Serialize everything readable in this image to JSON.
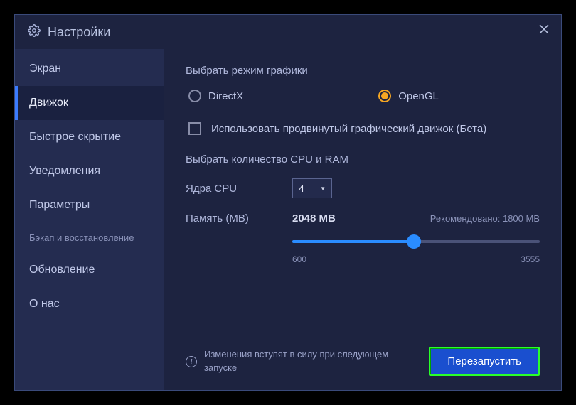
{
  "window": {
    "title": "Настройки"
  },
  "sidebar": {
    "items": [
      {
        "label": "Экран",
        "active": false,
        "small": false
      },
      {
        "label": "Движок",
        "active": true,
        "small": false
      },
      {
        "label": "Быстрое скрытие",
        "active": false,
        "small": false
      },
      {
        "label": "Уведомления",
        "active": false,
        "small": false
      },
      {
        "label": "Параметры",
        "active": false,
        "small": false
      },
      {
        "label": "Бэкап и восстановление",
        "active": false,
        "small": true
      },
      {
        "label": "Обновление",
        "active": false,
        "small": false
      },
      {
        "label": "О нас",
        "active": false,
        "small": false
      }
    ]
  },
  "content": {
    "graphics_mode_title": "Выбрать режим графики",
    "radio_directx": "DirectX",
    "radio_opengl": "OpenGL",
    "selected_graphics": "OpenGL",
    "advanced_engine_label": "Использовать продвинутый графический движок (Бета)",
    "advanced_engine_checked": false,
    "cpu_ram_title": "Выбрать количество CPU и RAM",
    "cpu_label": "Ядра CPU",
    "cpu_value": "4",
    "memory_label": "Память (МВ)",
    "memory_value": "2048 MB",
    "memory_recommended": "Рекомендовано: 1800 MB",
    "slider_min": "600",
    "slider_max": "3555",
    "slider_pct": 49,
    "footer_info": "Изменения вступят в силу при следующем запуске",
    "restart_label": "Перезапустить"
  }
}
